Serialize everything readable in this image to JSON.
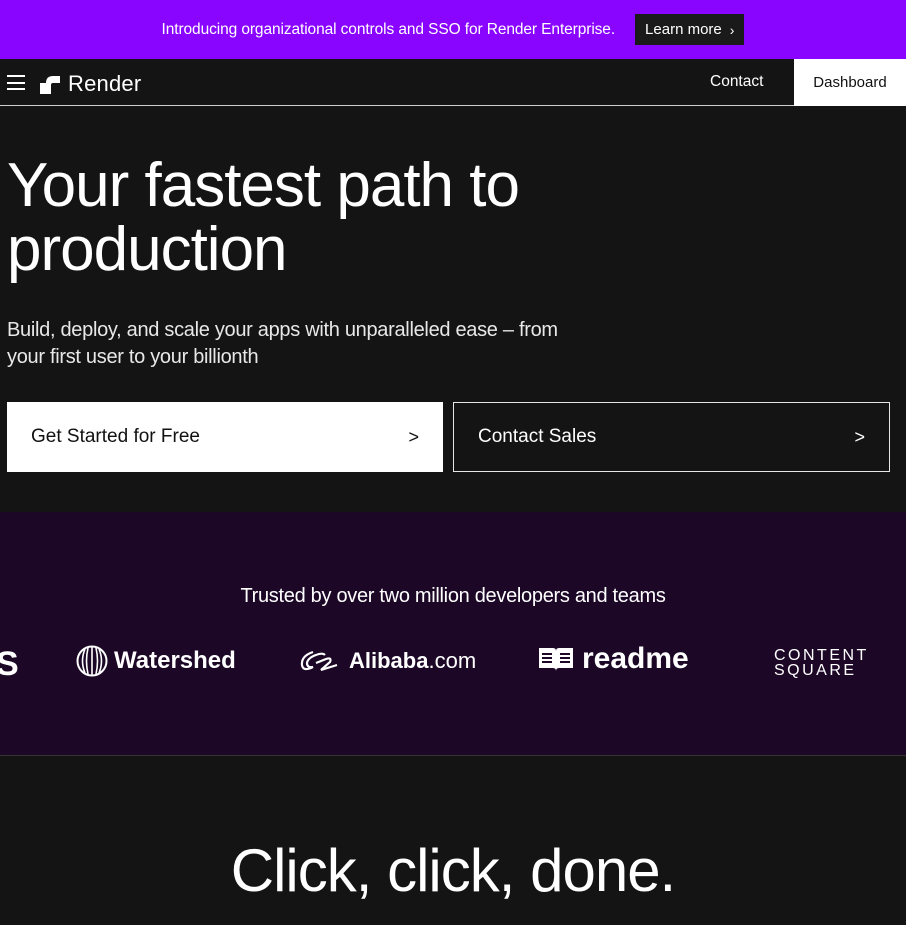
{
  "banner": {
    "text": "Introducing organizational controls and SSO for Render Enterprise.",
    "button_label": "Learn more",
    "button_icon": "chevron-right-icon"
  },
  "nav": {
    "menu_icon": "hamburger-icon",
    "logo_text": "Render",
    "contact_label": "Contact",
    "dashboard_label": "Dashboard"
  },
  "hero": {
    "title_line1": "Your fastest path to",
    "title_line2": "production",
    "subtitle_line1": "Build, deploy, and scale your apps with unparalleled ease – from",
    "subtitle_line2": "your first user to your billionth",
    "primary_cta": "Get Started for Free",
    "secondary_cta": "Contact Sales"
  },
  "trusted": {
    "title": "Trusted by over two million developers and teams",
    "logos": {
      "partial": "S",
      "watershed": "Watershed",
      "alibaba_name": "Alibaba",
      "alibaba_suffix": ".com",
      "readme": "readme",
      "contentsquare_line1": "CONTENT",
      "contentsquare_line2": "SQUARE"
    }
  },
  "section2": {
    "title": "Click, click, done."
  },
  "colors": {
    "banner": "#8a05ff",
    "page_bg": "#141414",
    "trusted_bg": "#1c0726"
  }
}
